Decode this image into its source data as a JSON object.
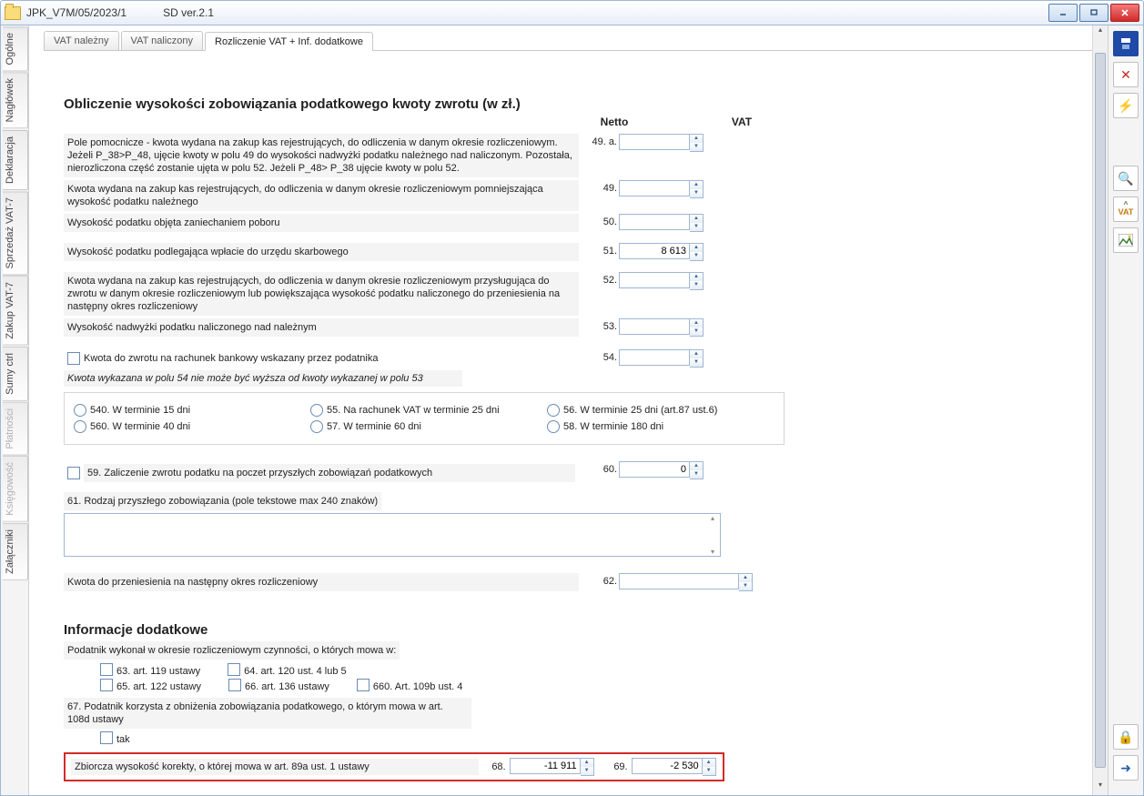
{
  "window": {
    "title": "JPK_V7M/05/2023/1",
    "version": "SD ver.2.1"
  },
  "left_tabs": [
    "Ogólne",
    "Nagłówek",
    "Deklaracja",
    "Sprzedaż VAT-7",
    "Zakup VAT-7",
    "Sumy ctrl",
    "Płatności",
    "Księgowość",
    "Załączniki"
  ],
  "top_tabs": [
    "VAT należny",
    "VAT naliczony",
    "Rozliczenie VAT + Inf. dodatkowe"
  ],
  "section1_title": "Obliczenie wysokości zobowiązania podatkowego kwoty zwrotu (w zł.)",
  "col_netto": "Netto",
  "col_vat": "VAT",
  "rows": {
    "r49a": {
      "label": "Pole pomocnicze - kwota wydana na zakup kas rejestrujących, do odliczenia w danym okresie rozliczeniowym. Jeżeli P_38>P_48, ujęcie kwoty w polu 49 do wysokości nadwyżki podatku należnego nad naliczonym. Pozostała, nierozliczona część zostanie ujęta w polu 52. Jeżeli P_48> P_38 ujęcie kwoty w polu 52.",
      "num": "49. a.",
      "val": ""
    },
    "r49": {
      "label": "Kwota wydana na zakup kas rejestrujących, do odliczenia w danym okresie rozliczeniowym pomniejszająca wysokość podatku należnego",
      "num": "49.",
      "val": ""
    },
    "r50": {
      "label": "Wysokość podatku objęta zaniechaniem poboru",
      "num": "50.",
      "val": ""
    },
    "r51": {
      "label": "Wysokość podatku podlegająca wpłacie do urzędu skarbowego",
      "num": "51.",
      "val": "8 613"
    },
    "r52": {
      "label": "Kwota wydana na zakup kas rejestrujących, do odliczenia w danym okresie rozliczeniowym przysługująca do zwrotu w danym okresie rozliczeniowym lub powiększająca wysokość podatku naliczonego do przeniesienia na następny okres rozliczeniowy",
      "num": "52.",
      "val": ""
    },
    "r53": {
      "label": "Wysokość nadwyżki podatku naliczonego nad należnym",
      "num": "53.",
      "val": ""
    },
    "r54": {
      "label": "Kwota do zwrotu na rachunek bankowy wskazany przez podatnika",
      "num": "54.",
      "val": ""
    },
    "note54": "Kwota wykazana w polu 54 nie może być wyższa od kwoty wykazanej w polu 53",
    "r60": {
      "num": "60.",
      "val": "0"
    },
    "r62": {
      "label": "Kwota do przeniesienia na następny okres rozliczeniowy",
      "num": "62.",
      "val": ""
    }
  },
  "radio_opts": {
    "o540": "540. W terminie 15 dni",
    "o55": "55. Na rachunek VAT w terminie 25 dni",
    "o56": "56. W terminie 25 dni (art.87 ust.6)",
    "o560": "560. W terminie 40 dni",
    "o57": "57. W terminie 60 dni",
    "o58": "58. W terminie 180 dni"
  },
  "chk59": "59. Zaliczenie zwrotu podatku na poczet przyszłych zobowiązań podatkowych",
  "lbl61": "61. Rodzaj przyszłego zobowiązania (pole tekstowe max 240 znaków)",
  "section2_title": "Informacje dodatkowe",
  "lbl_podatnik": "Podatnik wykonał w okresie rozliczeniowym czynności, o których mowa w:",
  "chk63": "63. art. 119 ustawy",
  "chk64": "64. art. 120 ust. 4 lub 5",
  "chk65": "65. art. 122 ustawy",
  "chk66": "66. art. 136 ustawy",
  "chk660": "660. Art. 109b ust. 4",
  "lbl67": "67. Podatnik korzysta z obniżenia zobowiązania podatkowego, o którym mowa w art. 108d ustawy",
  "chk_tak": "tak",
  "r68_label": "Zbiorcza wysokość korekty, o której mowa w art. 89a ust. 1 ustawy",
  "r68_num": "68.",
  "r68_val": "-11 911",
  "r69_num": "69.",
  "r69_val": "-2 530"
}
